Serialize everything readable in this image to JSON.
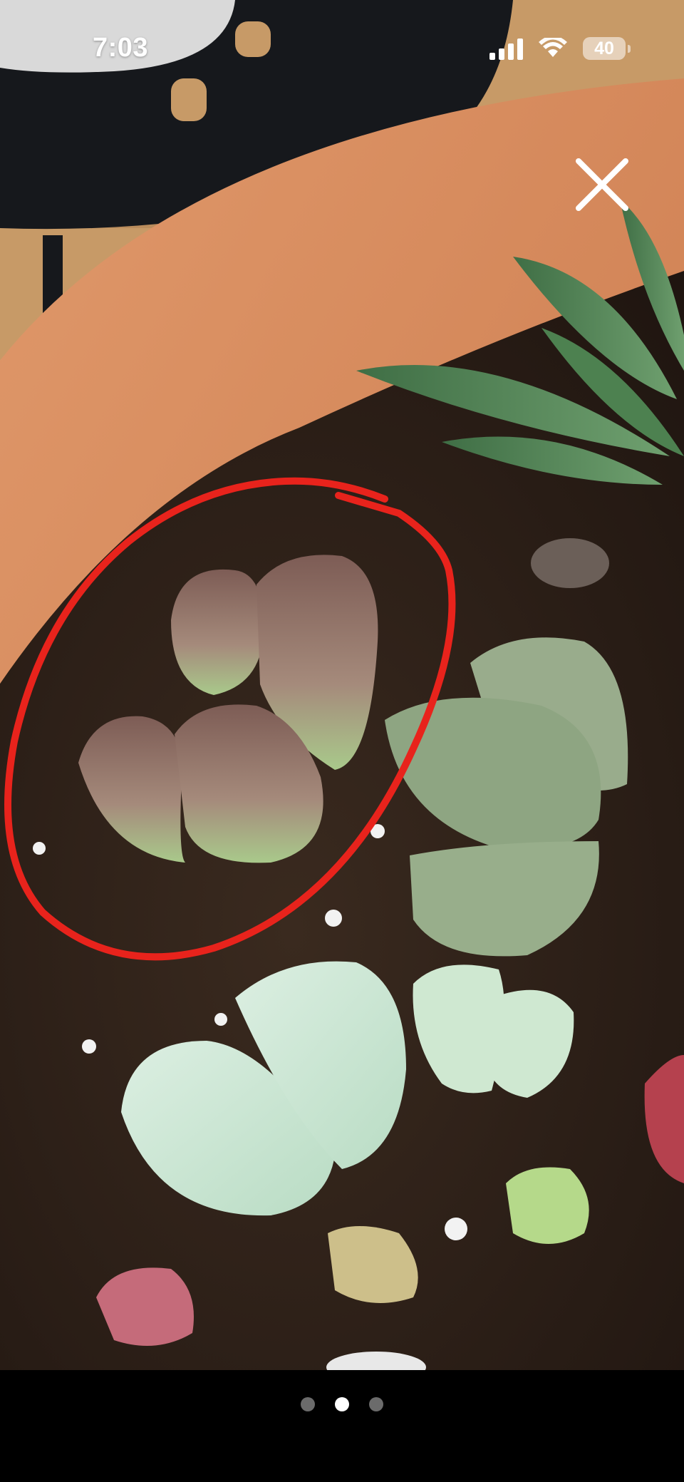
{
  "status_bar": {
    "time": "7:03",
    "battery": "40",
    "icons": [
      "signal-icon",
      "wifi-icon",
      "battery-icon"
    ]
  },
  "viewer": {
    "close_icon": "close-icon",
    "page_count": 3,
    "active_page": 2
  },
  "colors": {
    "annotation": "#e8231c",
    "pot": "#d4875b",
    "background_bar": "#000000",
    "dot_active": "#ffffff",
    "dot_inactive": "#6b6b6b"
  }
}
